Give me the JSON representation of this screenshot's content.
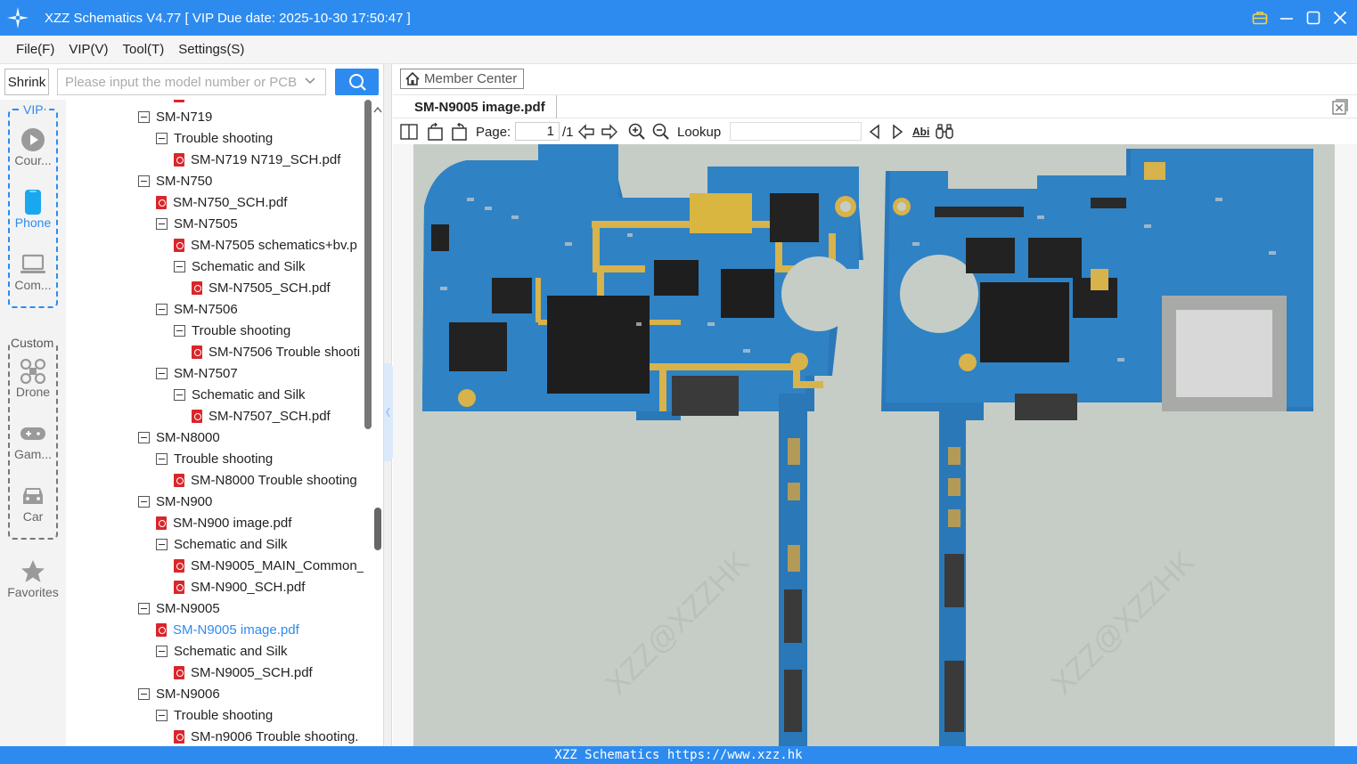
{
  "window": {
    "title": "XZZ Schematics V4.77 [ VIP Due date: 2025-10-30 17:50:47 ]"
  },
  "menu": [
    "File(F)",
    "VIP(V)",
    "Tool(T)",
    "Settings(S)"
  ],
  "toolbar": {
    "shrink_label": "Shrink",
    "search_placeholder": "Please input the model number or PCB"
  },
  "categories": {
    "vip_label": "VIP",
    "custom_label": "Custom",
    "items": [
      {
        "label": "Cour...",
        "icon": "play-icon"
      },
      {
        "label": "Phone",
        "icon": "phone-icon"
      },
      {
        "label": "Com...",
        "icon": "laptop-icon"
      },
      {
        "label": "Drone",
        "icon": "drone-icon"
      },
      {
        "label": "Gam...",
        "icon": "gamepad-icon"
      },
      {
        "label": "Car",
        "icon": "car-icon"
      },
      {
        "label": "Favorites",
        "icon": "star-icon"
      }
    ]
  },
  "tree": [
    {
      "label": "SM-N719",
      "kind": "folder",
      "level": 0
    },
    {
      "label": "Trouble shooting",
      "kind": "folder",
      "level": 1
    },
    {
      "label": "SM-N719 N719_SCH.pdf",
      "kind": "pdf",
      "level": 2
    },
    {
      "label": "SM-N750",
      "kind": "folder",
      "level": 0
    },
    {
      "label": "SM-N750_SCH.pdf",
      "kind": "pdf",
      "level": 1
    },
    {
      "label": "SM-N7505",
      "kind": "folder",
      "level": 1
    },
    {
      "label": "SM-N7505  schematics+bv.p",
      "kind": "pdf",
      "level": 2
    },
    {
      "label": "Schematic and Silk",
      "kind": "folder",
      "level": 2
    },
    {
      "label": "SM-N7505_SCH.pdf",
      "kind": "pdf",
      "level": 3
    },
    {
      "label": "SM-N7506",
      "kind": "folder",
      "level": 1
    },
    {
      "label": "Trouble shooting",
      "kind": "folder",
      "level": 2
    },
    {
      "label": "SM-N7506 Trouble shooti",
      "kind": "pdf",
      "level": 3
    },
    {
      "label": "SM-N7507",
      "kind": "folder",
      "level": 1
    },
    {
      "label": "Schematic and Silk",
      "kind": "folder",
      "level": 2
    },
    {
      "label": "SM-N7507_SCH.pdf",
      "kind": "pdf",
      "level": 3
    },
    {
      "label": "SM-N8000",
      "kind": "folder",
      "level": 0
    },
    {
      "label": "Trouble shooting",
      "kind": "folder",
      "level": 1
    },
    {
      "label": "SM-N8000 Trouble shooting",
      "kind": "pdf",
      "level": 2
    },
    {
      "label": "SM-N900",
      "kind": "folder",
      "level": 0
    },
    {
      "label": "SM-N900 image.pdf",
      "kind": "pdf",
      "level": 1
    },
    {
      "label": "Schematic and Silk",
      "kind": "folder",
      "level": 1
    },
    {
      "label": "SM-N9005_MAIN_Common_",
      "kind": "pdf",
      "level": 2
    },
    {
      "label": "SM-N900_SCH.pdf",
      "kind": "pdf",
      "level": 2
    },
    {
      "label": "SM-N9005",
      "kind": "folder",
      "level": 0
    },
    {
      "label": "SM-N9005 image.pdf",
      "kind": "pdf",
      "level": 1,
      "selected": true
    },
    {
      "label": "Schematic and Silk",
      "kind": "folder",
      "level": 1
    },
    {
      "label": "SM-N9005_SCH.pdf",
      "kind": "pdf",
      "level": 2
    },
    {
      "label": "SM-N9006",
      "kind": "folder",
      "level": 0
    },
    {
      "label": "Trouble shooting",
      "kind": "folder",
      "level": 1
    },
    {
      "label": "SM-n9006 Trouble shooting.",
      "kind": "pdf",
      "level": 2
    }
  ],
  "viewer": {
    "member_center": "Member Center",
    "tab_title": "SM-N9005 image.pdf",
    "page_label": "Page:",
    "page_current": "1",
    "page_total": "/1",
    "lookup_label": "Lookup",
    "abi_label": "Abi"
  },
  "footer": {
    "text": "XZZ Schematics https://www.xzz.hk"
  },
  "colors": {
    "accent": "#2d8bf0",
    "pdf_icon": "#d9262b",
    "pcb_blue": "#2a78b8",
    "pcb_gold": "#d8b24a"
  }
}
